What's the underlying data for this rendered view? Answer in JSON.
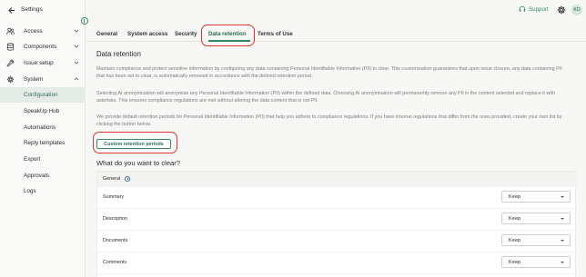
{
  "sidebar": {
    "back_label": "Settings",
    "items": [
      {
        "label": "Access",
        "icon": "users-icon"
      },
      {
        "label": "Components",
        "icon": "database-icon"
      },
      {
        "label": "Issue setup",
        "icon": "wrench-icon"
      },
      {
        "label": "System",
        "icon": "gear-icon"
      }
    ],
    "sub_items": [
      {
        "label": "Configuration",
        "active": true
      },
      {
        "label": "SpeakUp Hub"
      },
      {
        "label": "Automations"
      },
      {
        "label": "Reply templates"
      },
      {
        "label": "Export"
      },
      {
        "label": "Approvals"
      },
      {
        "label": "Logs"
      }
    ]
  },
  "topbar": {
    "support_label": "Support",
    "avatar_initials": "KD"
  },
  "tabs": [
    {
      "label": "General"
    },
    {
      "label": "System access"
    },
    {
      "label": "Security"
    },
    {
      "label": "Data retention",
      "active": true
    },
    {
      "label": "Terms of Use"
    }
  ],
  "main": {
    "title": "Data retention",
    "paragraphs": [
      "Maintain compliance and protect sensitive information by configuring any data containing Personal Identifiable Information (PII) to clear. This customisation guarantees that upon issue closure, any data containing PII that has been set to clear, is automatically removed in accordance with the defined retention period.",
      "Selecting AI anonymisation will anonymise any Personal Identifiable Information (PII) within the defined data. Choosing AI anonymisation will permanently remove any PII in the content selected and replace it with asterisks. This ensures compliance regulations are met without altering the data content that is not PII.",
      "We provide default retention periods for Personal Identifiable Information (PII) that help you adhere to compliance regulations. If you have internal regulations that differ from the ones provided, create your own list by clicking the button below."
    ],
    "custom_button_label": "Custom retention periods",
    "clear_title": "What do you want to clear?",
    "table": {
      "group_label": "General",
      "rows": [
        {
          "label": "Summary",
          "value": "Keep"
        },
        {
          "label": "Description",
          "value": "Keep"
        },
        {
          "label": "Documents",
          "value": "Keep"
        },
        {
          "label": "Comments",
          "value": "Keep"
        }
      ]
    }
  },
  "colors": {
    "accent": "#2f8a64",
    "highlight": "#d9382f"
  }
}
